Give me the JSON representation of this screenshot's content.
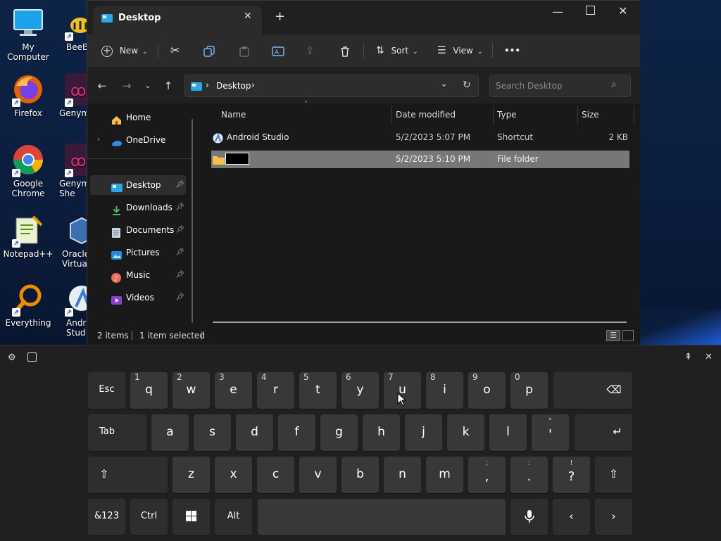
{
  "desktop": {
    "icons": [
      {
        "label": "My Computer",
        "name": "my-computer"
      },
      {
        "label": "Firefox",
        "name": "firefox"
      },
      {
        "label": "Google Chrome",
        "name": "google-chrome"
      },
      {
        "label": "Notepad++",
        "name": "notepad-plus-plus"
      },
      {
        "label": "Everything",
        "name": "everything"
      }
    ],
    "partial_icons": [
      {
        "label": "BeeBE",
        "name": "beebe"
      },
      {
        "label": "Genym",
        "name": "genymotion"
      },
      {
        "label": "Genym She",
        "name": "genymotion-shell"
      },
      {
        "label": "Oracle Virtua",
        "name": "oracle-virtualbox"
      },
      {
        "label": "Andr Stud",
        "name": "android-studio-desktop"
      }
    ]
  },
  "window": {
    "tab_title": "Desktop",
    "toolbar": {
      "new": "New",
      "sort": "Sort",
      "view": "View",
      "more": "•••"
    },
    "address": {
      "location": "Desktop",
      "search_placeholder": "Search Desktop"
    },
    "sidebar": {
      "items": [
        {
          "label": "Home",
          "pinned": false
        },
        {
          "label": "OneDrive",
          "pinned": false
        },
        {
          "label": "Desktop",
          "pinned": true
        },
        {
          "label": "Downloads",
          "pinned": true
        },
        {
          "label": "Documents",
          "pinned": true
        },
        {
          "label": "Pictures",
          "pinned": true
        },
        {
          "label": "Music",
          "pinned": true
        },
        {
          "label": "Videos",
          "pinned": true
        }
      ]
    },
    "columns": {
      "name": "Name",
      "date": "Date modified",
      "type": "Type",
      "size": "Size"
    },
    "files": [
      {
        "name": "Android Studio",
        "date": "5/2/2023 5:07 PM",
        "type": "Shortcut",
        "size": "2 KB"
      },
      {
        "name": "",
        "date": "5/2/2023 5:10 PM",
        "type": "File folder",
        "size": ""
      }
    ],
    "status": {
      "count": "2 items",
      "selected": "1 item selected"
    }
  },
  "keyboard": {
    "row1": [
      {
        "label": "Esc",
        "hint": ""
      },
      {
        "label": "q",
        "hint": "1"
      },
      {
        "label": "w",
        "hint": "2"
      },
      {
        "label": "e",
        "hint": "3"
      },
      {
        "label": "r",
        "hint": "4"
      },
      {
        "label": "t",
        "hint": "5"
      },
      {
        "label": "y",
        "hint": "6"
      },
      {
        "label": "u",
        "hint": "7"
      },
      {
        "label": "i",
        "hint": "8"
      },
      {
        "label": "o",
        "hint": "9"
      },
      {
        "label": "p",
        "hint": "0"
      }
    ],
    "row2": [
      {
        "label": "Tab"
      },
      {
        "label": "a"
      },
      {
        "label": "s"
      },
      {
        "label": "d"
      },
      {
        "label": "f"
      },
      {
        "label": "g"
      },
      {
        "label": "h"
      },
      {
        "label": "j"
      },
      {
        "label": "k"
      },
      {
        "label": "l"
      }
    ],
    "row2_quote": {
      "top": "\"",
      "bottom": "'"
    },
    "row3": [
      {
        "label": "z"
      },
      {
        "label": "x"
      },
      {
        "label": "c"
      },
      {
        "label": "v"
      },
      {
        "label": "b"
      },
      {
        "label": "n"
      },
      {
        "label": "m"
      }
    ],
    "row3_punct": [
      {
        "top": ";",
        "bottom": ","
      },
      {
        "top": ":",
        "bottom": "."
      },
      {
        "top": "!",
        "bottom": "?"
      }
    ],
    "row4": {
      "symbols": "&123",
      "ctrl": "Ctrl",
      "alt": "Alt"
    },
    "colors": {
      "key": "#383838",
      "key_dark": "#2e2e2e",
      "bg": "#202020",
      "selection": "#777777"
    }
  }
}
